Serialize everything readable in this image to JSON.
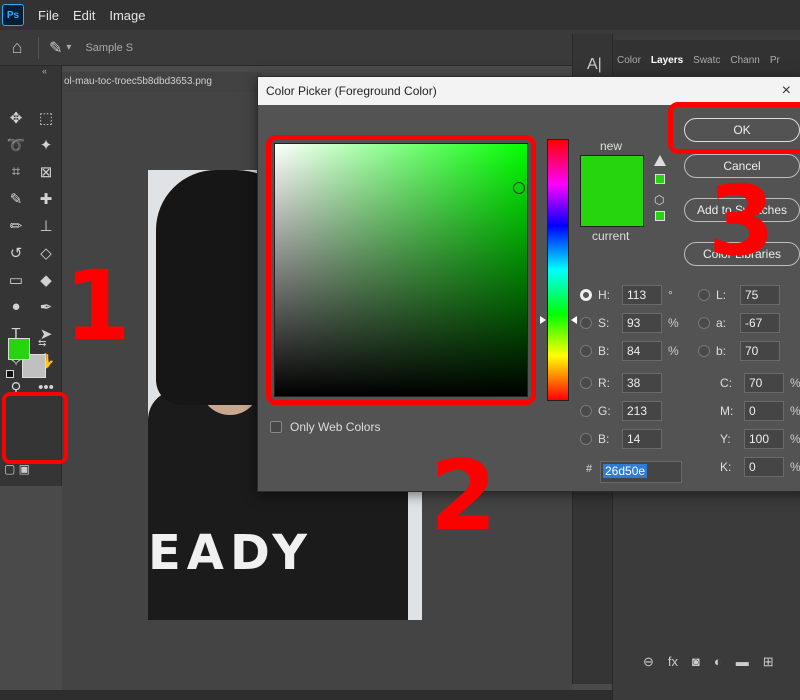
{
  "menubar": {
    "logo": "Ps",
    "items": [
      "File",
      "Edit",
      "Image"
    ]
  },
  "options": {
    "sample_label": "Sample S"
  },
  "tools": {
    "grid": [
      "move-icon",
      "marquee-icon",
      "lasso-icon",
      "magic-wand-icon",
      "crop-icon",
      "frame-icon",
      "eyedropper-icon",
      "healing-icon",
      "brush-icon",
      "stamp-icon",
      "history-brush-icon",
      "eraser-icon",
      "gradient-icon",
      "blur-icon",
      "dodge-icon",
      "pen-icon",
      "type-icon",
      "path-select-icon",
      "shape-icon",
      "hand-icon",
      "zoom-icon",
      "more-icon"
    ],
    "fg_color": "#26d50e",
    "bg_color": "#c0c0c0"
  },
  "document": {
    "tab": "ol-mau-toc-troec5b8dbd3653.png",
    "shirt_text": "EADY"
  },
  "right_panel": {
    "tabs": [
      {
        "label": "Color",
        "active": false
      },
      {
        "label": "Layers",
        "active": true
      },
      {
        "label": "Swatc",
        "active": false
      },
      {
        "label": "Chann",
        "active": false
      },
      {
        "label": "Pr",
        "active": false
      }
    ],
    "collapsed_icon": "A|"
  },
  "dialog": {
    "title": "Color Picker (Foreground Color)",
    "close": "×",
    "new_label": "new",
    "current_label": "current",
    "new_color": "#26d50e",
    "current_color": "#26d50e",
    "buttons": {
      "ok": "OK",
      "cancel": "Cancel",
      "add_swatches": "Add to Swatches",
      "libraries": "Color Libraries"
    },
    "hsb": [
      {
        "label": "H:",
        "value": "113",
        "unit": "°",
        "selected": true
      },
      {
        "label": "S:",
        "value": "93",
        "unit": "%",
        "selected": false
      },
      {
        "label": "B:",
        "value": "84",
        "unit": "%",
        "selected": false
      }
    ],
    "rgb": [
      {
        "label": "R:",
        "value": "38"
      },
      {
        "label": "G:",
        "value": "213"
      },
      {
        "label": "B:",
        "value": "14"
      }
    ],
    "lab": [
      {
        "label": "L:",
        "value": "75"
      },
      {
        "label": "a:",
        "value": "-67"
      },
      {
        "label": "b:",
        "value": "70"
      }
    ],
    "cmyk": [
      {
        "label": "C:",
        "value": "70",
        "unit": "%"
      },
      {
        "label": "M:",
        "value": "0",
        "unit": "%"
      },
      {
        "label": "Y:",
        "value": "100",
        "unit": "%"
      },
      {
        "label": "K:",
        "value": "0",
        "unit": "%"
      }
    ],
    "hex_label": "#",
    "hex": "26d50e",
    "web_colors_label": "Only Web Colors",
    "hue_position": 0.69
  },
  "annotations": {
    "step1": "1",
    "step2": "2",
    "step3": "3"
  }
}
